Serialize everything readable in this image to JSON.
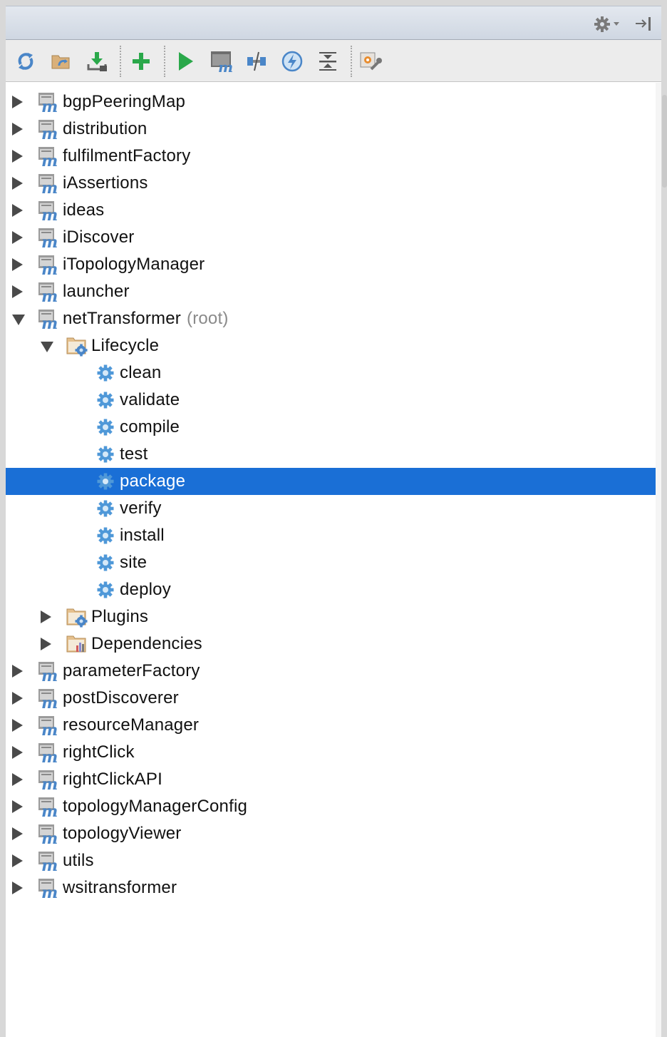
{
  "colors": {
    "selection": "#1a6fd6",
    "label": "#111111",
    "root_suffix": "#8a8a8a",
    "run_green": "#2aa84a",
    "maven_blue": "#4a86c8",
    "folder_tan": "#c9a36b"
  },
  "titlebar": {
    "settings_icon": "gear-icon",
    "hide_icon": "hide-panel-icon"
  },
  "toolbar": {
    "buttons": [
      {
        "name": "reimport-all-projects-button",
        "icon": "refresh-icon"
      },
      {
        "name": "generate-sources-button",
        "icon": "folder-refresh-icon"
      },
      {
        "name": "download-sources-button",
        "icon": "download-icon"
      },
      {
        "name": "add-maven-project-button",
        "icon": "plus-icon"
      },
      {
        "name": "run-maven-build-button",
        "icon": "play-icon"
      },
      {
        "name": "execute-maven-goal-button",
        "icon": "maven-terminal-icon"
      },
      {
        "name": "toggle-offline-mode-button",
        "icon": "offline-icon"
      },
      {
        "name": "skip-tests-button",
        "icon": "lightning-icon"
      },
      {
        "name": "collapse-all-button",
        "icon": "collapse-icon"
      },
      {
        "name": "maven-settings-button",
        "icon": "wrench-settings-icon"
      }
    ]
  },
  "tree": [
    {
      "label": "bgpPeeringMap",
      "level": 0,
      "kind": "module",
      "arrow": "right"
    },
    {
      "label": "distribution",
      "level": 0,
      "kind": "module",
      "arrow": "right"
    },
    {
      "label": "fulfilmentFactory",
      "level": 0,
      "kind": "module",
      "arrow": "right"
    },
    {
      "label": "iAssertions",
      "level": 0,
      "kind": "module",
      "arrow": "right"
    },
    {
      "label": "ideas",
      "level": 0,
      "kind": "module",
      "arrow": "right"
    },
    {
      "label": "iDiscover",
      "level": 0,
      "kind": "module",
      "arrow": "right"
    },
    {
      "label": "iTopologyManager",
      "level": 0,
      "kind": "module",
      "arrow": "right"
    },
    {
      "label": "launcher",
      "level": 0,
      "kind": "module",
      "arrow": "right"
    },
    {
      "label": "netTransformer",
      "suffix": "(root)",
      "level": 0,
      "kind": "module",
      "arrow": "down"
    },
    {
      "label": "Lifecycle",
      "level": 1,
      "kind": "folder-gear",
      "arrow": "down"
    },
    {
      "label": "clean",
      "level": 2,
      "kind": "goal",
      "arrow": "none"
    },
    {
      "label": "validate",
      "level": 2,
      "kind": "goal",
      "arrow": "none"
    },
    {
      "label": "compile",
      "level": 2,
      "kind": "goal",
      "arrow": "none"
    },
    {
      "label": "test",
      "level": 2,
      "kind": "goal",
      "arrow": "none"
    },
    {
      "label": "package",
      "level": 2,
      "kind": "goal",
      "arrow": "none",
      "selected": true
    },
    {
      "label": "verify",
      "level": 2,
      "kind": "goal",
      "arrow": "none"
    },
    {
      "label": "install",
      "level": 2,
      "kind": "goal",
      "arrow": "none"
    },
    {
      "label": "site",
      "level": 2,
      "kind": "goal",
      "arrow": "none"
    },
    {
      "label": "deploy",
      "level": 2,
      "kind": "goal",
      "arrow": "none"
    },
    {
      "label": "Plugins",
      "level": 1,
      "kind": "folder-gear",
      "arrow": "right"
    },
    {
      "label": "Dependencies",
      "level": 1,
      "kind": "folder-chart",
      "arrow": "right"
    },
    {
      "label": "parameterFactory",
      "level": 0,
      "kind": "module",
      "arrow": "right"
    },
    {
      "label": "postDiscoverer",
      "level": 0,
      "kind": "module",
      "arrow": "right"
    },
    {
      "label": "resourceManager",
      "level": 0,
      "kind": "module",
      "arrow": "right"
    },
    {
      "label": "rightClick",
      "level": 0,
      "kind": "module",
      "arrow": "right"
    },
    {
      "label": "rightClickAPI",
      "level": 0,
      "kind": "module",
      "arrow": "right"
    },
    {
      "label": "topologyManagerConfig",
      "level": 0,
      "kind": "module",
      "arrow": "right"
    },
    {
      "label": "topologyViewer",
      "level": 0,
      "kind": "module",
      "arrow": "right"
    },
    {
      "label": "utils",
      "level": 0,
      "kind": "module",
      "arrow": "right"
    },
    {
      "label": "wsitransformer",
      "level": 0,
      "kind": "module",
      "arrow": "right"
    }
  ]
}
